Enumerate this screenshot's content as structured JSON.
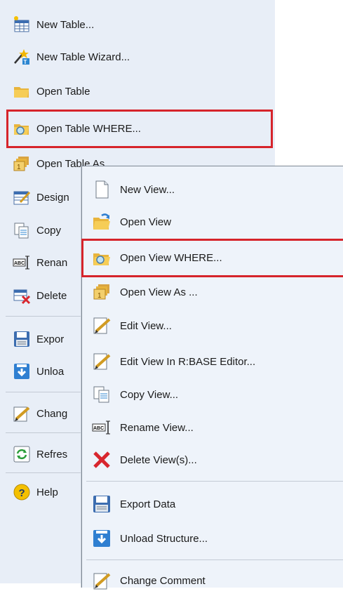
{
  "main_menu": {
    "items": [
      {
        "label": "New Table...",
        "icon": "new-table-icon"
      },
      {
        "label": "New Table Wizard...",
        "icon": "wizard-icon"
      },
      {
        "label": "Open Table",
        "icon": "folder-icon"
      },
      {
        "label": "Open Table WHERE...",
        "icon": "folder-search-icon"
      },
      {
        "label": "Open Table As ...",
        "icon": "open-as-icon"
      },
      {
        "label": "Design",
        "icon": "design-icon"
      },
      {
        "label": "Copy",
        "icon": "copy-icon"
      },
      {
        "label": "Renan",
        "icon": "rename-icon"
      },
      {
        "label": "Delete",
        "icon": "delete-icon"
      },
      {
        "label": "Expor",
        "icon": "floppy-icon"
      },
      {
        "label": "Unloa",
        "icon": "unload-icon"
      },
      {
        "label": "Chang",
        "icon": "pencil-icon"
      },
      {
        "label": "Refres",
        "icon": "refresh-icon"
      },
      {
        "label": "Help",
        "icon": "help-icon"
      }
    ]
  },
  "submenu": {
    "items": [
      {
        "label": "New View...",
        "icon": "new-document-icon"
      },
      {
        "label": "Open View",
        "icon": "folder-open-icon"
      },
      {
        "label": "Open View WHERE...",
        "icon": "folder-search-icon"
      },
      {
        "label": "Open View As ...",
        "icon": "open-as-icon"
      },
      {
        "label": "Edit View...",
        "icon": "edit-icon"
      },
      {
        "label": "Edit View In R:BASE Editor...",
        "icon": "edit-icon"
      },
      {
        "label": "Copy View...",
        "icon": "copy-icon"
      },
      {
        "label": "Rename View...",
        "icon": "rename-icon"
      },
      {
        "label": "Delete View(s)...",
        "icon": "delete-x-icon"
      },
      {
        "label": "Export Data",
        "icon": "floppy-icon"
      },
      {
        "label": "Unload Structure...",
        "icon": "unload-icon"
      },
      {
        "label": "Change Comment",
        "icon": "pencil-icon"
      }
    ]
  },
  "colors": {
    "menu_bg": "#e8eef7",
    "highlight": "#d6242b",
    "submenu_bg": "#eef3fa"
  }
}
